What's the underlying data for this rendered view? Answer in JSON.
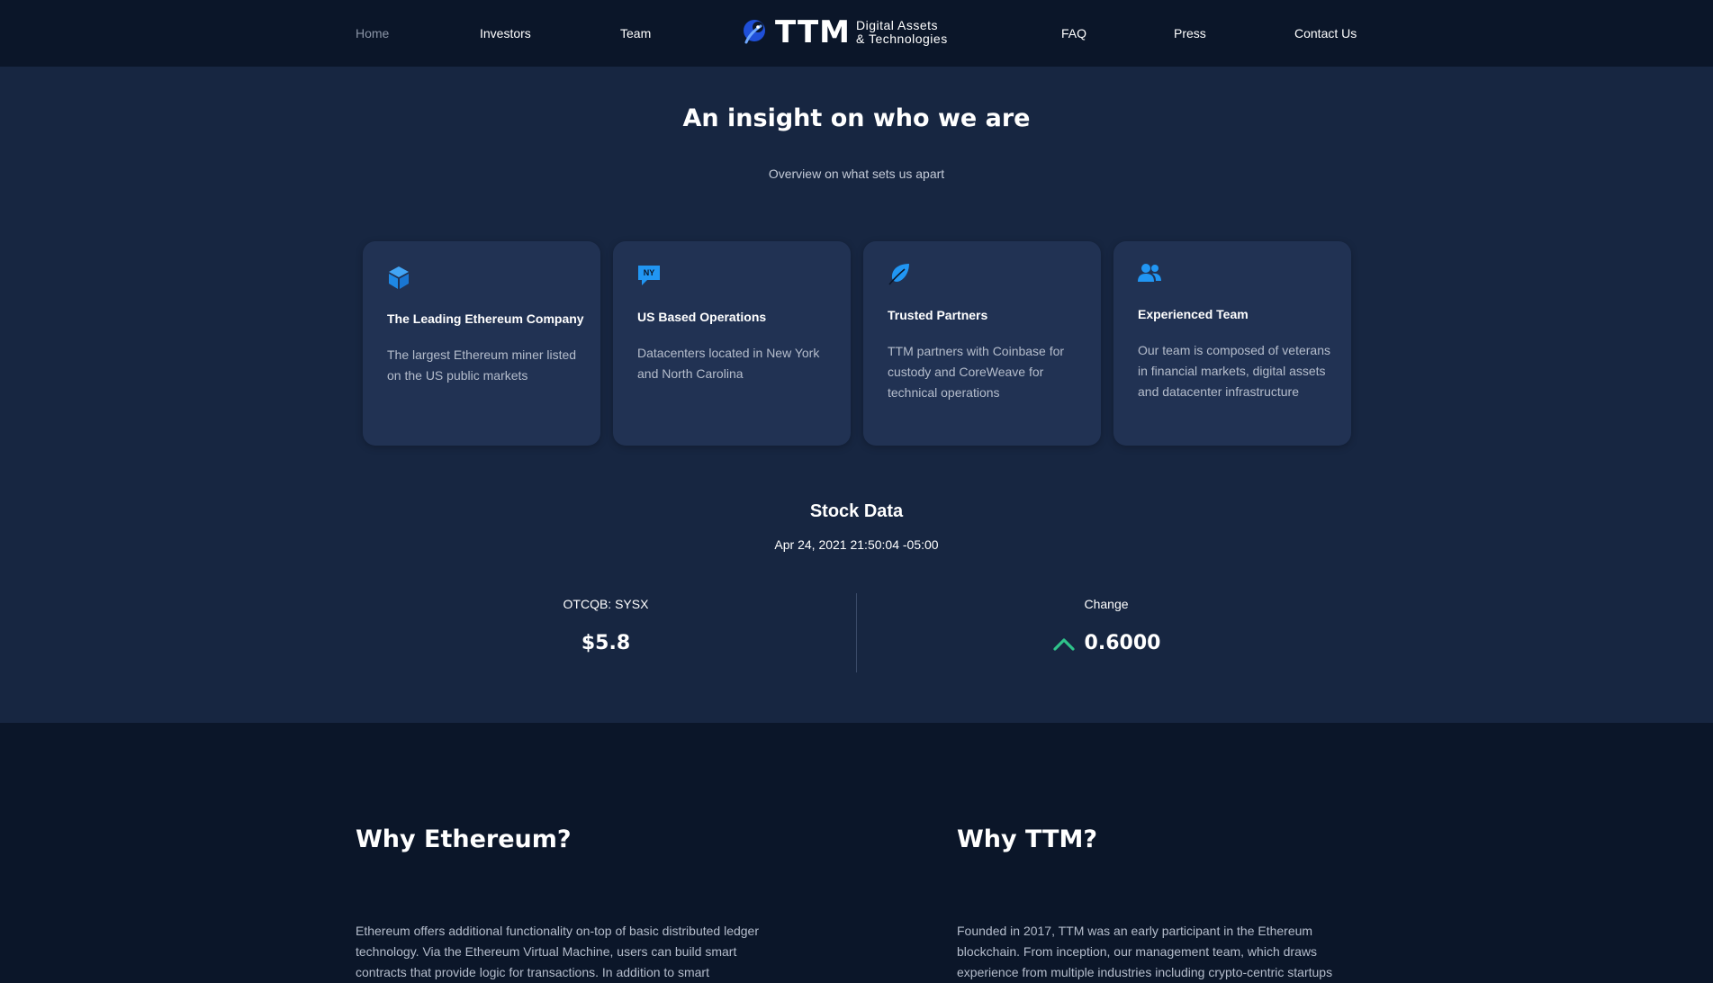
{
  "nav": {
    "items": [
      {
        "label": "Home",
        "active": true
      },
      {
        "label": "Investors"
      },
      {
        "label": "Team"
      },
      {
        "label": "FAQ"
      },
      {
        "label": "Press"
      },
      {
        "label": "Contact Us"
      }
    ],
    "logo": {
      "ttm": "TTM",
      "line1": "Digital Assets",
      "line2": "& Technologies"
    }
  },
  "insight": {
    "title": "An insight on who we are",
    "subtitle": "Overview on what sets us apart",
    "cards": [
      {
        "icon": "cube-icon",
        "title": "The Leading Ethereum Company",
        "desc": "The largest Ethereum miner listed on the US public markets"
      },
      {
        "icon": "ny-chat-icon",
        "title": "US Based Operations",
        "desc": "Datacenters located in New York and North Carolina"
      },
      {
        "icon": "leaf-icon",
        "title": "Trusted Partners",
        "desc": "TTM partners with Coinbase for custody and CoreWeave for technical operations"
      },
      {
        "icon": "users-icon",
        "title": "Experienced Team",
        "desc": "Our team is composed of veterans in financial markets, digital assets and datacenter infrastructure"
      }
    ]
  },
  "stock": {
    "title": "Stock Data",
    "date": "Apr 24, 2021 21:50:04 -05:00",
    "ticker_label": "OTCQB: SYSX",
    "price": "$5.8",
    "change_label": "Change",
    "change_value": "0.6000",
    "change_direction": "up"
  },
  "why": {
    "ethereum_title": "Why Ethereum?",
    "ethereum_text": "Ethereum offers additional functionality on-top of basic distributed ledger technology. Via the Ethereum Virtual Machine, users can build smart contracts that provide logic for transactions. In addition to smart",
    "ttm_title": "Why TTM?",
    "ttm_text": "Founded in 2017, TTM was an early participant in the Ethereum blockchain. From inception, our management team, which draws experience from multiple industries including crypto-centric startups"
  },
  "colors": {
    "nav_bg": "#0b1629",
    "section_bg": "#172641",
    "card_bg": "#213253",
    "accent_blue": "#2196f3",
    "up_green": "#2fc38a"
  }
}
